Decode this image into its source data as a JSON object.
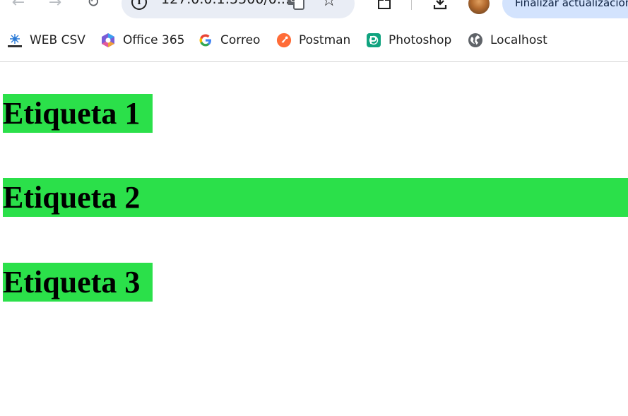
{
  "browser": {
    "omnibox": {
      "url": "127.0.0.1:5500/0..."
    },
    "update_button": {
      "label": "Finalizar actualización"
    },
    "icons": {
      "back": "back-arrow-icon",
      "forward": "forward-arrow-icon",
      "reload": "reload-icon",
      "info": "site-info-icon",
      "translate": "translate-icon",
      "bookmark": "star-icon",
      "extensions": "extensions-icon",
      "downloads": "download-icon",
      "profile": "avatar"
    }
  },
  "bookmarks": [
    {
      "label": "WEB CSV",
      "icon": "webcsv-icon"
    },
    {
      "label": "Office 365",
      "icon": "office365-icon"
    },
    {
      "label": "Correo",
      "icon": "google-icon"
    },
    {
      "label": "Postman",
      "icon": "postman-icon"
    },
    {
      "label": "Photoshop",
      "icon": "photoshop-icon"
    },
    {
      "label": "Localhost",
      "icon": "globe-icon"
    }
  ],
  "page": {
    "labels": [
      {
        "text": "Etiqueta 1"
      },
      {
        "text": "Etiqueta 2"
      },
      {
        "text": "Etiqueta 3"
      }
    ],
    "colors": {
      "label_background": "#2be04a",
      "label_text": "#000000"
    }
  }
}
